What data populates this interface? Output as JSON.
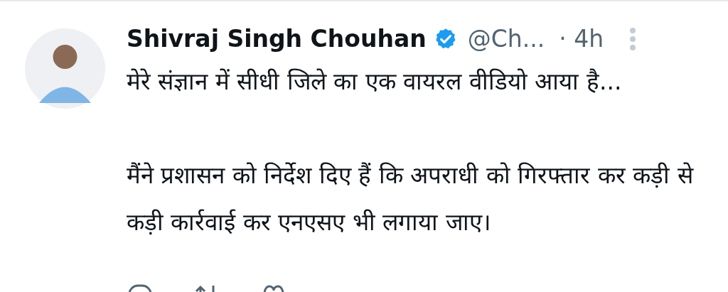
{
  "tweet": {
    "author": "Shivraj Singh Chouhan",
    "verified": true,
    "handle": "@Ch...",
    "time": "· 4h",
    "paragraphs": [
      "मेरे संज्ञान में सीधी जिले का एक वायरल वीडियो आया है...",
      "मैंने प्रशासन को निर्देश दिए हैं कि अपराधी को गिरफ्तार कर कड़ी से कड़ी कार्रवाई कर एनएसए भी लगाया जाए।"
    ]
  }
}
